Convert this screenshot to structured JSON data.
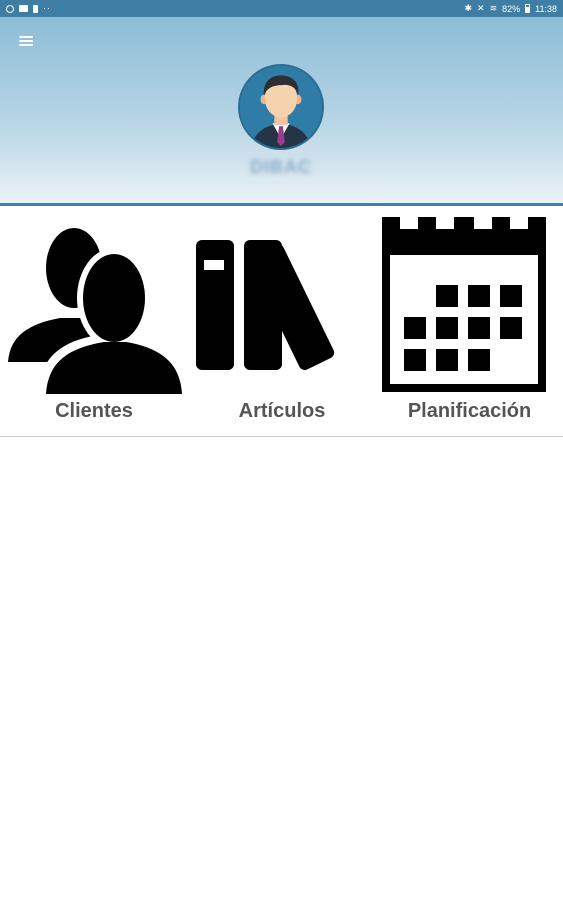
{
  "status_bar": {
    "battery": "82%",
    "time": "11:38",
    "left_icons": [
      "sync-icon",
      "mail-icon",
      "sd-card-icon",
      "more-dots-icon"
    ],
    "right_icons": [
      "bluetooth-icon",
      "mute-icon",
      "wifi-icon",
      "battery-icon"
    ]
  },
  "header": {
    "menu_icon": "hamburger-menu-icon",
    "avatar_icon": "user-avatar-icon",
    "user_name": "DIBAC"
  },
  "tiles": [
    {
      "label": "Clientes",
      "icon": "clients-icon"
    },
    {
      "label": "Artículos",
      "icon": "books-icon"
    },
    {
      "label": "Planificación",
      "icon": "calendar-icon"
    }
  ],
  "colors": {
    "status_bar": "#3f7ea4",
    "header_top": "#8dbdd6",
    "header_bottom": "#eaf2f7",
    "accent_line": "#3e83ad",
    "avatar_bg": "#2f7da6",
    "label_text": "#555555"
  }
}
